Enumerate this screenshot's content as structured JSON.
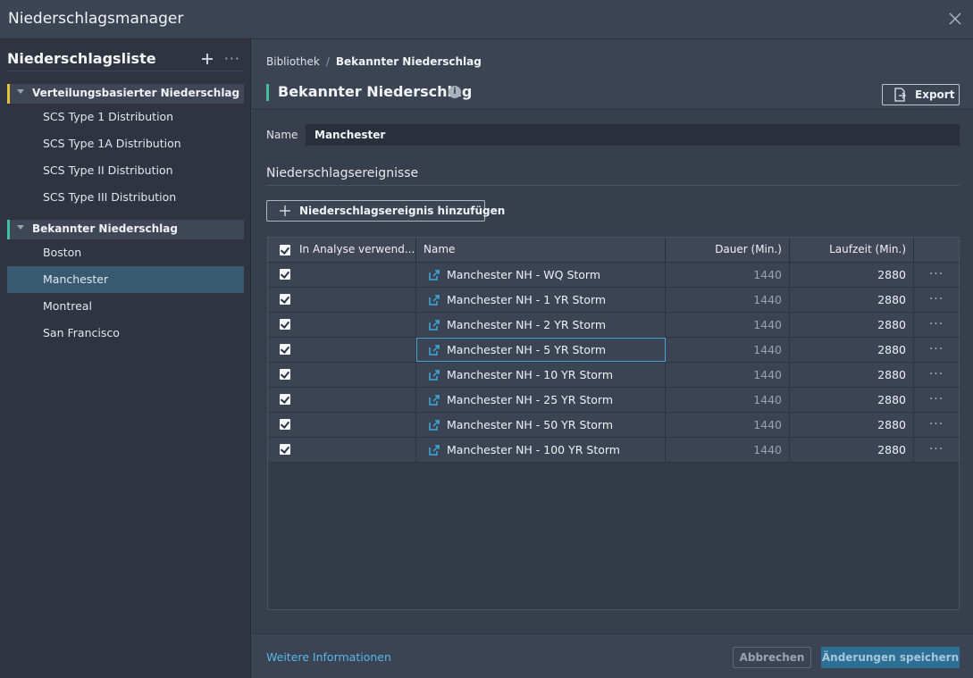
{
  "window": {
    "title": "Niederschlagsmanager"
  },
  "left": {
    "header": "Niederschlagsliste",
    "groups": [
      {
        "label": "Verteilungsbasierter Niederschlag",
        "color": "#e6c23a",
        "items": [
          "SCS Type 1 Distribution",
          "SCS Type 1A Distribution",
          "SCS Type II Distribution",
          "SCS Type III Distribution"
        ]
      },
      {
        "label": "Bekannter Niederschlag",
        "color": "#3fbf9a",
        "items": [
          "Boston",
          "Manchester",
          "Montreal",
          "San Francisco"
        ],
        "selected": "Manchester"
      }
    ]
  },
  "right": {
    "breadcrumb": {
      "root": "Bibliothek",
      "separator": "/",
      "current": "Bekannter Niederschlag"
    },
    "title": "Bekannter Niederschlag",
    "info_icon": "i",
    "export_label": "Export",
    "name_label": "Name",
    "name_value": "Manchester",
    "events_title": "Niederschlagsereignisse",
    "add_event_label": "Niederschlagsereignis hinzufügen",
    "table": {
      "columns": [
        "In Analyse verwend...",
        "Name",
        "Dauer (Min.)",
        "Laufzeit (Min.)"
      ],
      "rows": [
        {
          "checked": true,
          "name": "Manchester NH - WQ Storm",
          "duration": "1440",
          "runtime": "2880"
        },
        {
          "checked": true,
          "name": "Manchester NH - 1 YR Storm",
          "duration": "1440",
          "runtime": "2880"
        },
        {
          "checked": true,
          "name": "Manchester NH - 2 YR Storm",
          "duration": "1440",
          "runtime": "2880"
        },
        {
          "checked": true,
          "name": "Manchester NH - 5 YR Storm",
          "duration": "1440",
          "runtime": "2880"
        },
        {
          "checked": true,
          "name": "Manchester NH - 10 YR Storm",
          "duration": "1440",
          "runtime": "2880"
        },
        {
          "checked": true,
          "name": "Manchester NH - 25 YR Storm",
          "duration": "1440",
          "runtime": "2880"
        },
        {
          "checked": true,
          "name": "Manchester NH - 50 YR Storm",
          "duration": "1440",
          "runtime": "2880"
        },
        {
          "checked": true,
          "name": "Manchester NH - 100 YR Storm",
          "duration": "1440",
          "runtime": "2880"
        }
      ],
      "row_menu": "···"
    },
    "footer": {
      "more_info": "Weitere Informationen",
      "cancel": "Abbrechen",
      "save": "Änderungen speichern"
    }
  },
  "colors": {
    "accent": "#59b7ea",
    "selection": "#375a70",
    "primary": "#2e6f95"
  }
}
